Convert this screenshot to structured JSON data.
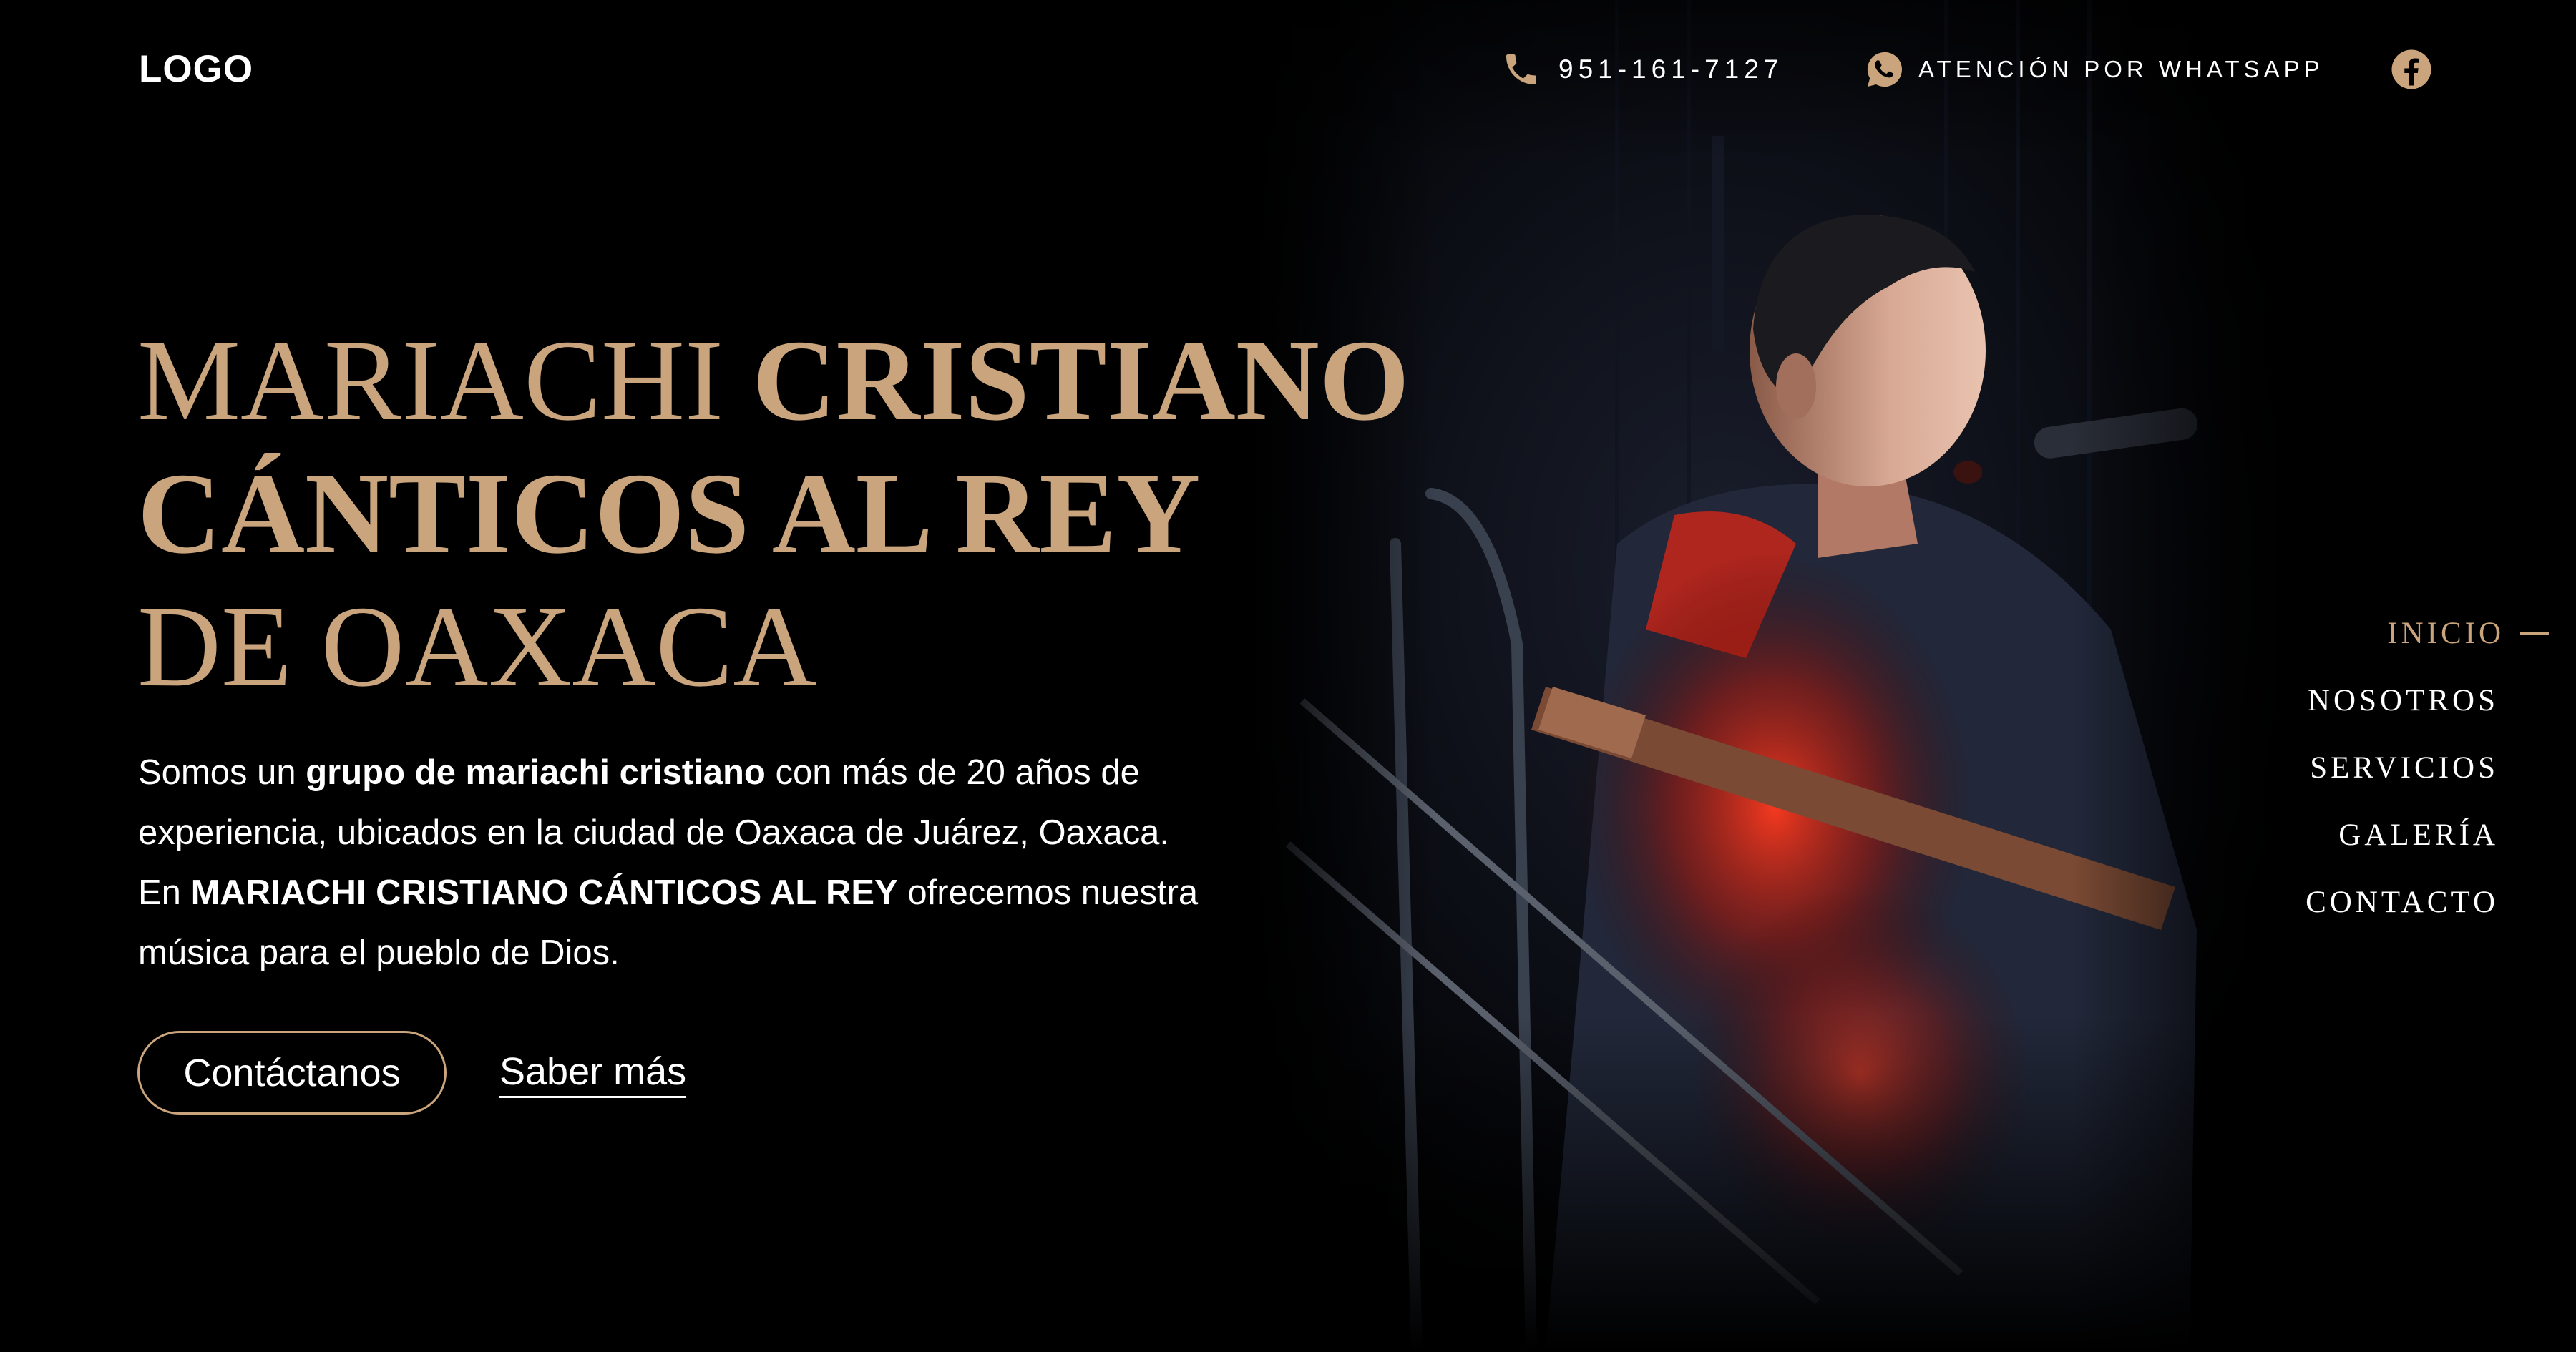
{
  "header": {
    "logo": "LOGO",
    "phone": "951-161-7127",
    "whatsapp": "ATENCIÓN POR WHATSAPP",
    "phone_icon": "phone-icon",
    "whatsapp_icon": "whatsapp-icon",
    "facebook_icon": "facebook-icon"
  },
  "hero": {
    "title": {
      "line1_light": "MARIACHI",
      "line1_bold": "CRISTIANO",
      "line2_bold": "CÁNTICOS AL REY",
      "line3_light": "DE OAXACA"
    },
    "description": {
      "p1": "Somos un ",
      "p1_bold": "grupo de mariachi cristiano",
      "p1_end": " con más de 20 años de",
      "p2": "experiencia, ubicados en la ciudad de Oaxaca de Juárez, Oaxaca.",
      "p3": "En ",
      "p3_bold": "MARIACHI CRISTIANO CÁNTICOS AL REY",
      "p3_end": " ofrecemos nuestra",
      "p4": "música para el pueblo de Dios."
    },
    "primary_button": "Contáctanos",
    "secondary_link": "Saber más"
  },
  "nav": {
    "items": [
      {
        "label": "INICIO",
        "active": true
      },
      {
        "label": "NOSOTROS",
        "active": false
      },
      {
        "label": "SERVICIOS",
        "active": false
      },
      {
        "label": "GALERÍA",
        "active": false
      },
      {
        "label": "CONTACTO",
        "active": false
      }
    ]
  },
  "colors": {
    "background": "#000000",
    "accent": "#c9a47c",
    "text": "#ffffff"
  }
}
